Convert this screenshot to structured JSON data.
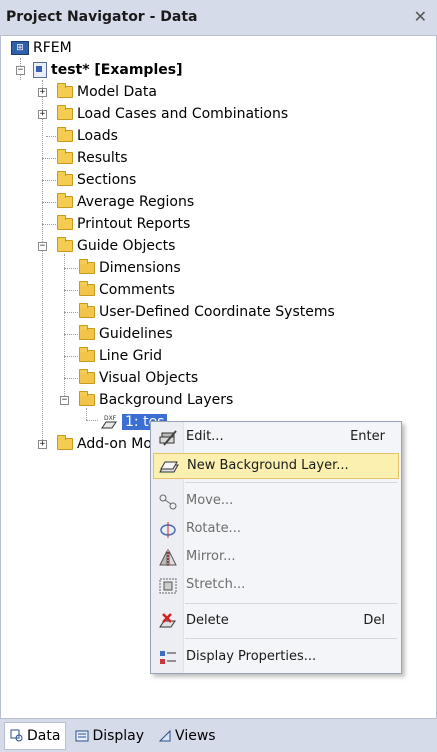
{
  "window": {
    "title": "Project Navigator - Data",
    "close_glyph": "✕"
  },
  "tree": {
    "root": "RFEM",
    "project": "test* [Examples]",
    "items": [
      {
        "label": "Model Data"
      },
      {
        "label": "Load Cases and Combinations"
      },
      {
        "label": "Loads"
      },
      {
        "label": "Results"
      },
      {
        "label": "Sections"
      },
      {
        "label": "Average Regions"
      },
      {
        "label": "Printout Reports"
      },
      {
        "label": "Guide Objects"
      },
      {
        "label": "Add-on Mo"
      }
    ],
    "guide_children": [
      {
        "label": "Dimensions"
      },
      {
        "label": "Comments"
      },
      {
        "label": "User-Defined Coordinate Systems"
      },
      {
        "label": "Guidelines"
      },
      {
        "label": "Line Grid"
      },
      {
        "label": "Visual Objects"
      },
      {
        "label": "Background Layers"
      }
    ],
    "layer_item": "1: tes",
    "dxf_tag": "DXF"
  },
  "context_menu": {
    "items": [
      {
        "label": "Edit...",
        "shortcut": "Enter",
        "icon": "edit-icon"
      },
      {
        "label": "New Background Layer...",
        "shortcut": "",
        "icon": "new-layer-icon"
      },
      {
        "label": "Move...",
        "shortcut": "",
        "icon": "move-icon"
      },
      {
        "label": "Rotate...",
        "shortcut": "",
        "icon": "rotate-icon"
      },
      {
        "label": "Mirror...",
        "shortcut": "",
        "icon": "mirror-icon"
      },
      {
        "label": "Stretch...",
        "shortcut": "",
        "icon": "stretch-icon"
      },
      {
        "label": "Delete",
        "shortcut": "Del",
        "icon": "delete-icon"
      },
      {
        "label": "Display Properties...",
        "shortcut": "",
        "icon": "display-properties-icon"
      }
    ]
  },
  "bottom_tabs": [
    {
      "label": "Data",
      "active": true
    },
    {
      "label": "Display",
      "active": false
    },
    {
      "label": "Views",
      "active": false
    }
  ],
  "colors": {
    "accent": "#3b6fd4",
    "highlight": "#fbf0b0",
    "folder": "#f5cc52"
  }
}
